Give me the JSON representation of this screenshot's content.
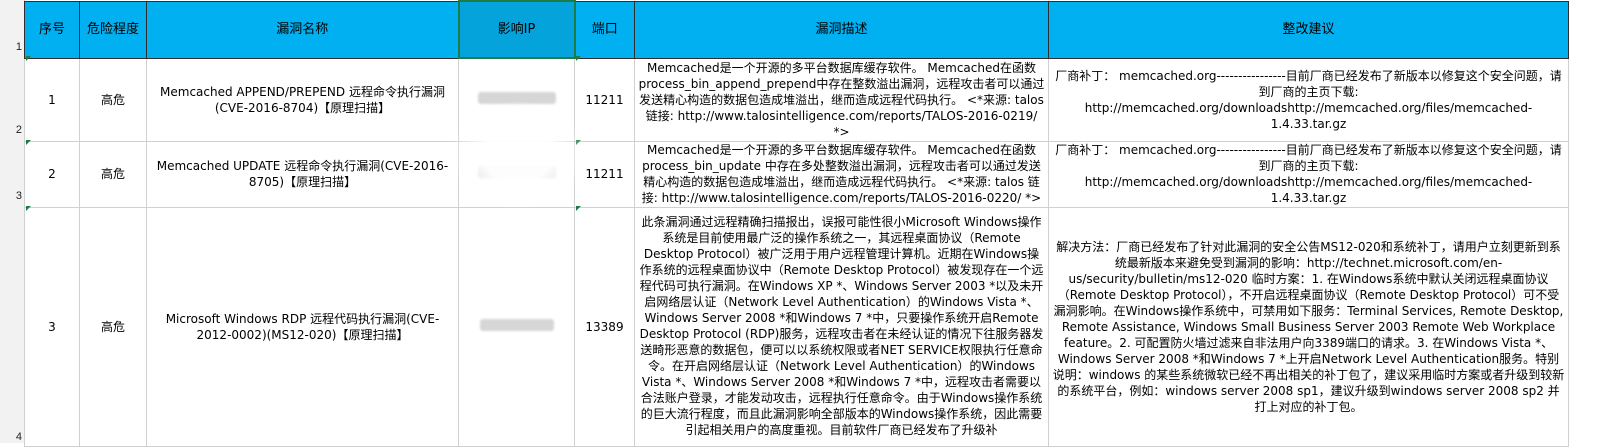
{
  "row_numbers": [
    "1",
    "2",
    "3",
    "4"
  ],
  "headers": {
    "seq": "序号",
    "risk": "危险程度",
    "name": "漏洞名称",
    "ip": "影响IP",
    "port": "端口",
    "desc": "漏洞描述",
    "advice": "整改建议"
  },
  "rows": [
    {
      "seq": "1",
      "risk": "高危",
      "name": "Memcached APPEND/PREPEND 远程命令执行漏洞(CVE-2016-8704)【原理扫描】",
      "ip": "",
      "port": "11211",
      "desc": "Memcached是一个开源的多平台数据库缓存软件。 Memcached在函数process_bin_append_prepend中存在整数溢出漏洞，远程攻击者可以通过发送精心构造的数据包造成堆溢出，继而造成远程代码执行。 <*来源: talos      链接: http://www.talosintelligence.com/reports/TALOS-2016-0219/ *>",
      "advice": "厂商补丁： memcached.org----------------目前厂商已经发布了新版本以修复这个安全问题，请到厂商的主页下载: http://memcached.org/downloadshttp://memcached.org/files/memcached-1.4.33.tar.gz"
    },
    {
      "seq": "2",
      "risk": "高危",
      "name": "Memcached UPDATE 远程命令执行漏洞(CVE-2016-8705)【原理扫描】",
      "ip": "",
      "port": "11211",
      "desc": "Memcached是一个开源的多平台数据库缓存软件。 Memcached在函数process_bin_update 中存在多处整数溢出漏洞，远程攻击者可以通过发送精心构造的数据包造成堆溢出，继而造成远程代码执行。 <*来源: talos      链接: http://www.talosintelligence.com/reports/TALOS-2016-0220/ *>",
      "advice": "厂商补丁： memcached.org----------------目前厂商已经发布了新版本以修复这个安全问题，请到厂商的主页下载: http://memcached.org/downloadshttp://memcached.org/files/memcached-1.4.33.tar.gz"
    },
    {
      "seq": "3",
      "risk": "高危",
      "name": "Microsoft Windows RDP 远程代码执行漏洞(CVE-2012-0002)(MS12-020)【原理扫描】",
      "ip": "",
      "port": "13389",
      "desc": "此条漏洞通过远程精确扫描报出，误报可能性很小Microsoft Windows操作系统是目前使用最广泛的操作系统之一，其远程桌面协议（Remote Desktop Protocol）被广泛用于用户远程管理计算机。近期在Windows操作系统的远程桌面协议中（Remote Desktop Protocol）被发现存在一个远程代码可执行漏洞。在Windows XP *、Windows Server 2003 *以及未开启网络层认证（Network Level Authentication）的Windows Vista *、Windows Server 2008 *和Windows 7 *中，只要操作系统开启Remote Desktop Protocol (RDP)服务，远程攻击者在未经认证的情况下往服务器发送畸形恶意的数据包，便可以以系统权限或者NET SERVICE权限执行任意命令。在开启网络层认证（Network Level Authentication）的Windows Vista *、Windows Server 2008 *和Windows 7 *中，远程攻击者需要以合法账户登录，才能发动攻击，远程执行任意命令。由于Windows操作系统的巨大流行程度，而且此漏洞影响全部版本的Windows操作系统，因此需要引起相关用户的高度重视。目前软件厂商已经发布了升级补",
      "advice": "解决方法：厂商已经发布了针对此漏洞的安全公告MS12-020和系统补丁，请用户立刻更新到系统最新版本来避免受到漏洞的影响：http://technet.microsoft.com/en-us/security/bulletin/ms12-020 临时方案：1.   在Windows系统中默认关闭远程桌面协议（Remote Desktop Protocol），不开启远程桌面协议（Remote Desktop Protocol）可不受漏洞影响。在Windows操作系统中，可禁用如下服务：Terminal Services, Remote Desktop, Remote Assistance, Windows Small Business Server 2003 Remote Web Workplace feature。2.   可配置防火墙过滤来自非法用户向3389端口的请求。3.   在Windows Vista *、Windows Server 2008 *和Windows 7 *上开启Network Level Authentication服务。特别说明：windows 的某些系统微软已经不再出相关的补丁包了，建议采用临时方案或者升级到较新的系统平台，例如：windows server 2008 sp1，建议升级到windows  server 2008 sp2 并打上对应的补丁包。"
    }
  ]
}
